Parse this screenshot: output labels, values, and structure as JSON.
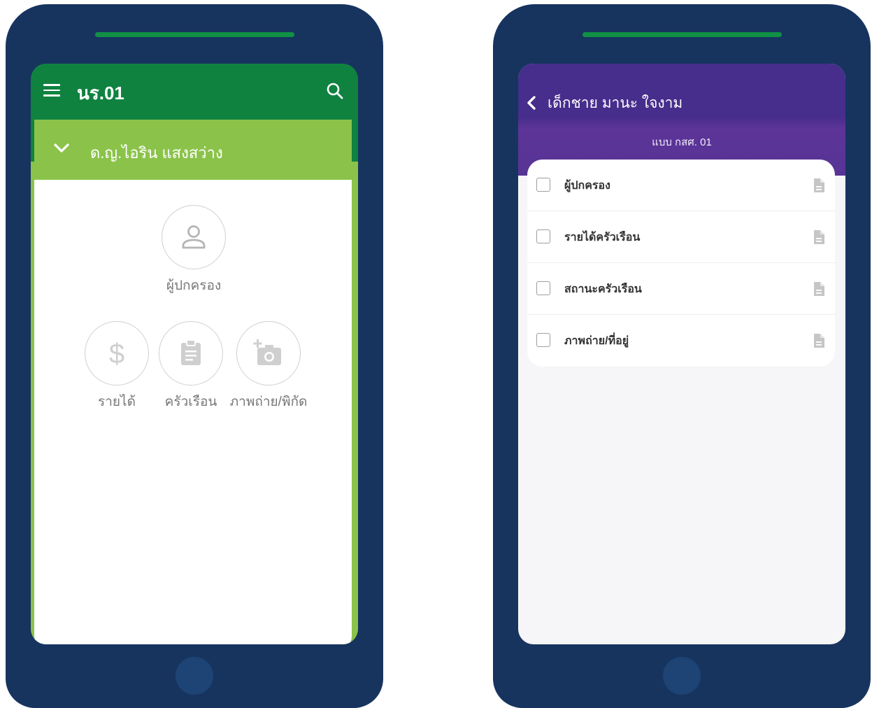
{
  "left_screen": {
    "app_title": "นร.01",
    "card_title": "ด.ญ.ไอริน แสงสว่าง",
    "menu_items": [
      {
        "label": "ผู้ปกครอง",
        "icon": "person-icon"
      },
      {
        "label": "รายได้",
        "icon": "dollar-icon"
      },
      {
        "label": "ครัวเรือน",
        "icon": "clipboard-icon"
      },
      {
        "label": "ภาพถ่าย/พิกัด",
        "icon": "add-photo-icon"
      }
    ],
    "colors": {
      "app_bar": "#108240",
      "card_header": "#8bc34a",
      "icon_gray": "#cccccc"
    }
  },
  "right_screen": {
    "header_title": "เด็กชาย มานะ ใจงาม",
    "header_subtitle": "แบบ กสศ. 01",
    "items": [
      {
        "label": "ผู้ปกครอง",
        "checked": false
      },
      {
        "label": "รายได้ครัวเรือน",
        "checked": false
      },
      {
        "label": "สถานะครัวเรือน",
        "checked": false
      },
      {
        "label": "ภาพถ่าย/ที่อยู่",
        "checked": false
      }
    ],
    "colors": {
      "header": "#472d8c",
      "background": "#f6f5f7"
    }
  },
  "device_colors": {
    "frame": "#17345f",
    "speaker": "#119145",
    "home_button": "#1d4474"
  }
}
